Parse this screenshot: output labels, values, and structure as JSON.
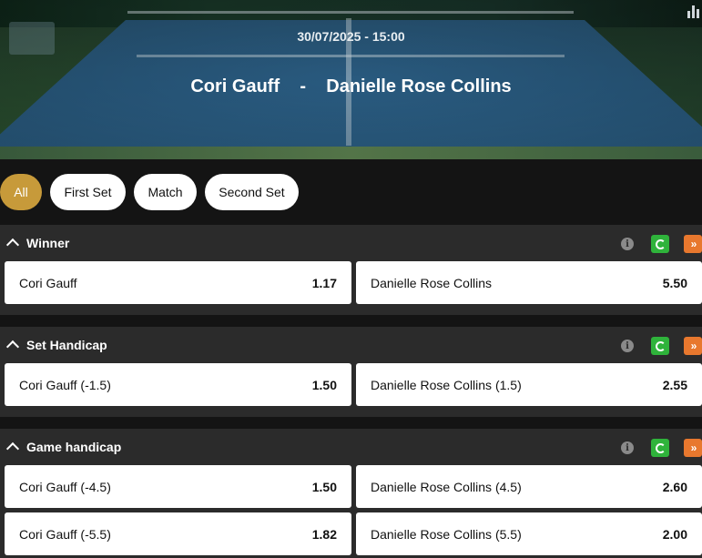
{
  "header": {
    "date": "30/07/2025 - 15:00",
    "home_player": "Cori Gauff",
    "separator": "-",
    "away_player": "Danielle Rose Collins",
    "stats_icon": "bar-chart-icon"
  },
  "filters": [
    {
      "label": "All",
      "active": true
    },
    {
      "label": "First Set",
      "active": false
    },
    {
      "label": "Match",
      "active": false
    },
    {
      "label": "Second Set",
      "active": false
    }
  ],
  "markets": [
    {
      "title": "Winner",
      "rows": [
        [
          {
            "label": "Cori Gauff",
            "price": "1.17"
          },
          {
            "label": "Danielle Rose Collins",
            "price": "5.50"
          }
        ]
      ]
    },
    {
      "title": "Set Handicap",
      "rows": [
        [
          {
            "label": "Cori Gauff (-1.5)",
            "price": "1.50"
          },
          {
            "label": "Danielle Rose Collins (1.5)",
            "price": "2.55"
          }
        ]
      ]
    },
    {
      "title": "Game handicap",
      "rows": [
        [
          {
            "label": "Cori Gauff (-4.5)",
            "price": "1.50"
          },
          {
            "label": "Danielle Rose Collins (4.5)",
            "price": "2.60"
          }
        ],
        [
          {
            "label": "Cori Gauff (-5.5)",
            "price": "1.82"
          },
          {
            "label": "Danielle Rose Collins (5.5)",
            "price": "2.00"
          }
        ]
      ]
    }
  ],
  "icons": {
    "info": "i",
    "more": "»",
    "accent_active_pill": "#c79a3a",
    "cashout_color": "#2fb33b",
    "more_color": "#e8782e"
  }
}
